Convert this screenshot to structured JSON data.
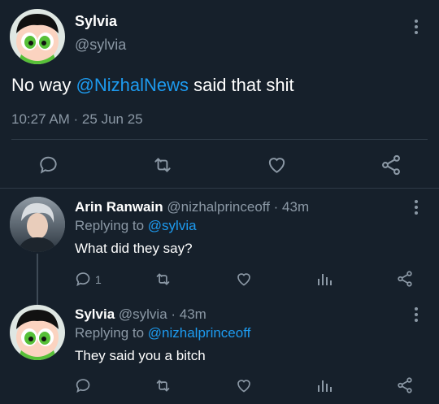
{
  "main_tweet": {
    "name": "Sylvia",
    "handle": "@sylvia",
    "text_prefix": "No way ",
    "mention": "@NizhalNews",
    "text_suffix": " said that shit",
    "timestamp": "10:27 AM · 25 Jun 25"
  },
  "replies": [
    {
      "name": "Arin Ranwain",
      "handle": "@nizhalprinceoff",
      "age": "· 43m",
      "replying_prefix": "Replying to ",
      "replying_to": "@sylvia",
      "text": "What did they say?",
      "reply_count": "1"
    },
    {
      "name": "Sylvia",
      "handle": "@sylvia",
      "age": "· 43m",
      "replying_prefix": "Replying to ",
      "replying_to": "@nizhalprinceoff",
      "text": "They said you a bitch",
      "reply_count": ""
    }
  ],
  "icons": {
    "reply": "reply-icon",
    "retweet": "retweet-icon",
    "like": "heart-icon",
    "share": "share-icon",
    "stats": "stats-icon",
    "more": "more-vertical-icon"
  },
  "colors": {
    "background": "#16202b",
    "accent": "#1d9bf0",
    "muted": "#8b98a5",
    "divider": "#2f3b47"
  }
}
